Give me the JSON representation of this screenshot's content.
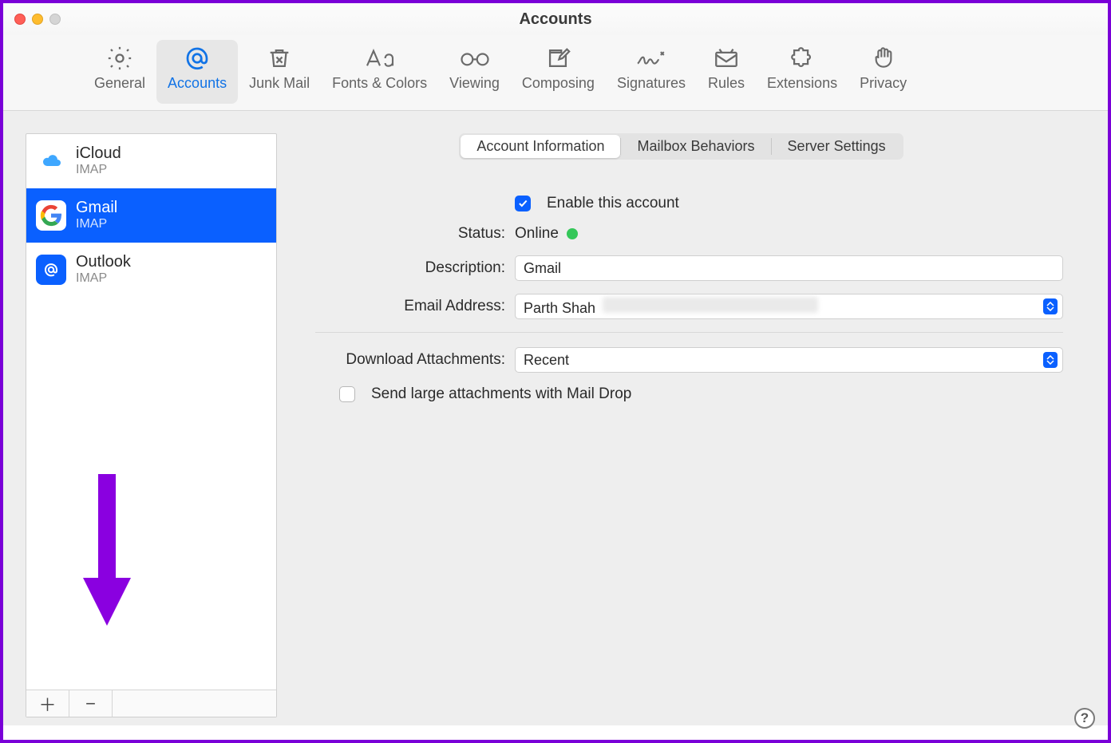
{
  "window": {
    "title": "Accounts"
  },
  "toolbar": [
    {
      "id": "general",
      "label": "General"
    },
    {
      "id": "accounts",
      "label": "Accounts"
    },
    {
      "id": "junk",
      "label": "Junk Mail"
    },
    {
      "id": "fonts",
      "label": "Fonts & Colors"
    },
    {
      "id": "viewing",
      "label": "Viewing"
    },
    {
      "id": "composing",
      "label": "Composing"
    },
    {
      "id": "signatures",
      "label": "Signatures"
    },
    {
      "id": "rules",
      "label": "Rules"
    },
    {
      "id": "extensions",
      "label": "Extensions"
    },
    {
      "id": "privacy",
      "label": "Privacy"
    }
  ],
  "toolbar_selected": "accounts",
  "accounts": [
    {
      "name": "iCloud",
      "protocol": "IMAP",
      "icon": "icloud"
    },
    {
      "name": "Gmail",
      "protocol": "IMAP",
      "icon": "gmail"
    },
    {
      "name": "Outlook",
      "protocol": "IMAP",
      "icon": "outlook"
    }
  ],
  "accounts_selected_index": 1,
  "sidebar_footer": {
    "add": "＋",
    "remove": "−"
  },
  "tabs": {
    "items": [
      "Account Information",
      "Mailbox Behaviors",
      "Server Settings"
    ],
    "selected_index": 0
  },
  "form": {
    "enable_label": "Enable this account",
    "enable_checked": true,
    "status_label": "Status:",
    "status_value": "Online",
    "description_label": "Description:",
    "description_value": "Gmail",
    "email_label": "Email Address:",
    "email_display_name": "Parth Shah",
    "download_label": "Download Attachments:",
    "download_value": "Recent",
    "maildrop_label": "Send large attachments with Mail Drop",
    "maildrop_checked": false
  },
  "help_label": "?"
}
